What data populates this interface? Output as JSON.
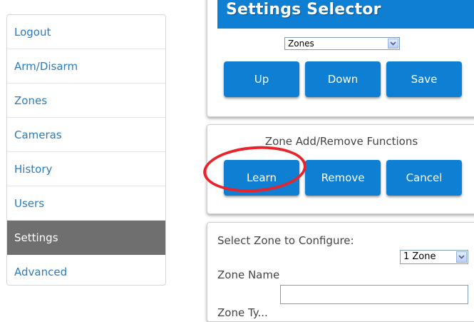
{
  "sidebar": {
    "items": [
      {
        "label": "Logout"
      },
      {
        "label": "Arm/Disarm"
      },
      {
        "label": "Zones"
      },
      {
        "label": "Cameras"
      },
      {
        "label": "History"
      },
      {
        "label": "Users"
      },
      {
        "label": "Settings",
        "active": true
      },
      {
        "label": "Advanced"
      }
    ]
  },
  "settings_panel": {
    "title": "Settings Selector",
    "selector_value": "Zones",
    "buttons": {
      "up": "Up",
      "down": "Down",
      "save": "Save"
    }
  },
  "zone_functions": {
    "caption": "Zone Add/Remove Functions",
    "buttons": {
      "learn": "Learn",
      "remove": "Remove",
      "cancel": "Cancel"
    }
  },
  "zone_config": {
    "select_label": "Select Zone to Configure:",
    "zone_select_value": "1 Zone",
    "zone_name_label": "Zone Name",
    "zone_name_value": "",
    "zone_type_label": "Zone Ty..."
  },
  "colors": {
    "accent": "#0f7fd4",
    "sidebar_active": "#6f6f6f",
    "annotation_ring": "#e8232b"
  }
}
